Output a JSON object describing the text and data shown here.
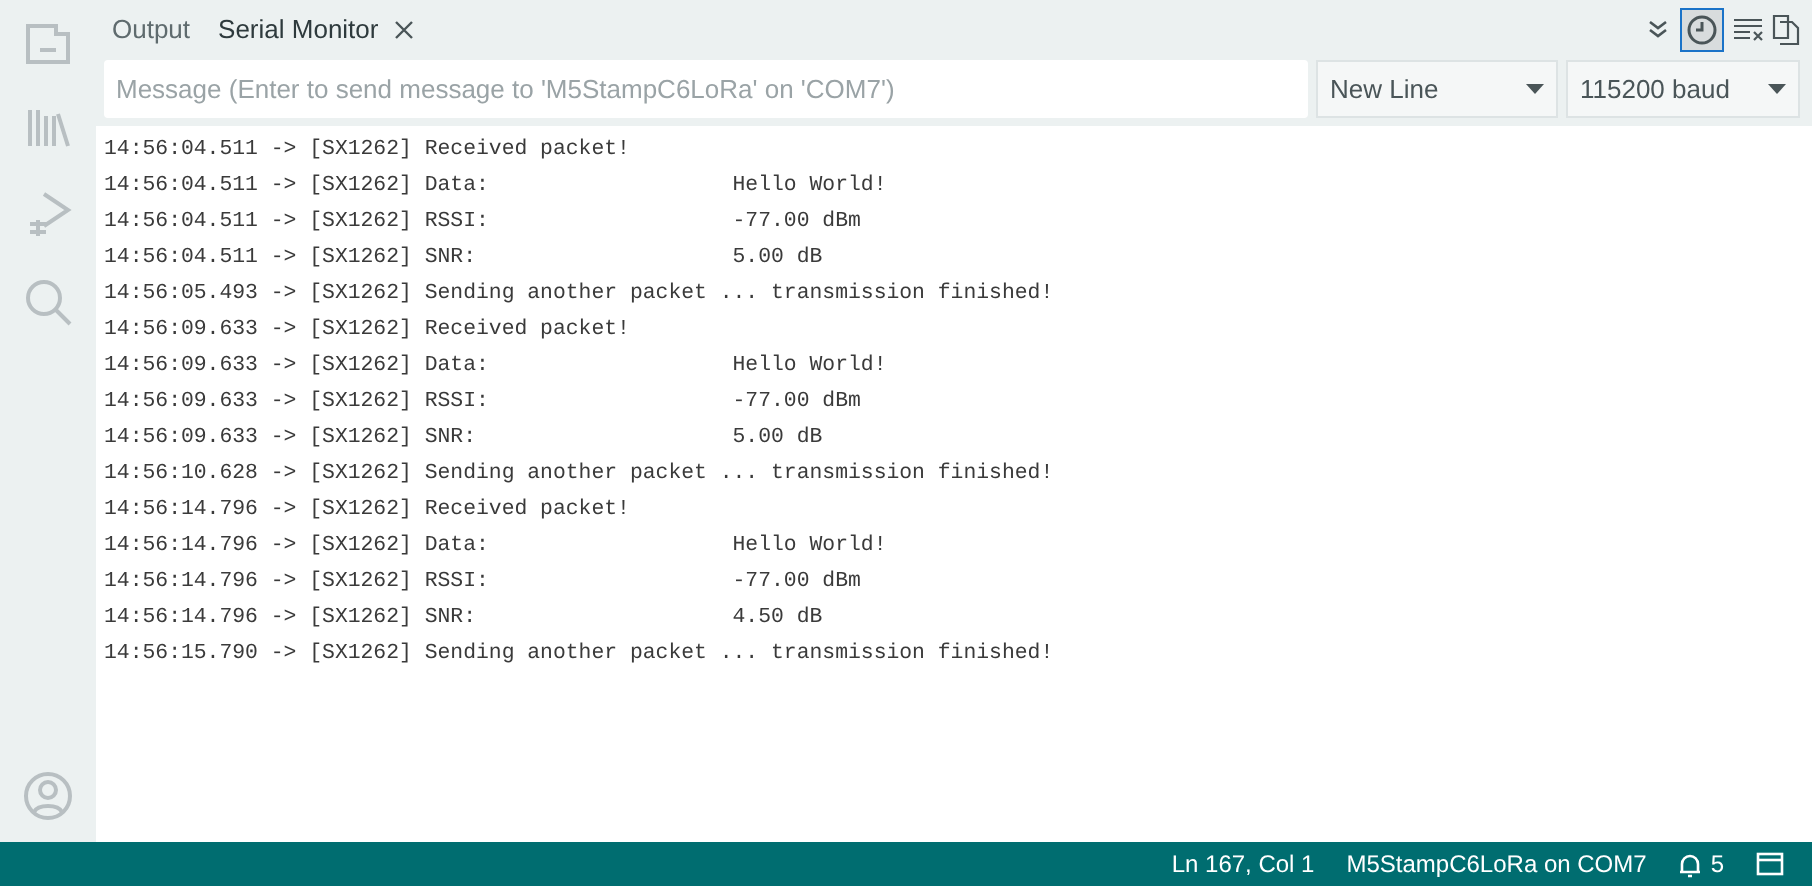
{
  "tabs": [
    {
      "label": "Output",
      "selected": false,
      "closable": false
    },
    {
      "label": "Serial Monitor",
      "selected": true,
      "closable": true
    }
  ],
  "toolbar": {
    "timestamp_on": true
  },
  "message": {
    "placeholder": "Message (Enter to send message to 'M5StampC6LoRa' on 'COM7')"
  },
  "line_ending": {
    "value": "New Line"
  },
  "baud": {
    "value": "115200 baud"
  },
  "log": [
    "14:56:04.511 -> [SX1262] Received packet!",
    "14:56:04.511 -> [SX1262] Data:                   Hello World!",
    "14:56:04.511 -> [SX1262] RSSI:                   -77.00 dBm",
    "14:56:04.511 -> [SX1262] SNR:                    5.00 dB",
    "14:56:05.493 -> [SX1262] Sending another packet ... transmission finished!",
    "14:56:09.633 -> [SX1262] Received packet!",
    "14:56:09.633 -> [SX1262] Data:                   Hello World!",
    "14:56:09.633 -> [SX1262] RSSI:                   -77.00 dBm",
    "14:56:09.633 -> [SX1262] SNR:                    5.00 dB",
    "14:56:10.628 -> [SX1262] Sending another packet ... transmission finished!",
    "14:56:14.796 -> [SX1262] Received packet!",
    "14:56:14.796 -> [SX1262] Data:                   Hello World!",
    "14:56:14.796 -> [SX1262] RSSI:                   -77.00 dBm",
    "14:56:14.796 -> [SX1262] SNR:                    4.50 dB",
    "14:56:15.790 -> [SX1262] Sending another packet ... transmission finished!"
  ],
  "status_bar": {
    "position": "Ln 167, Col 1",
    "board": "M5StampC6LoRa on COM7",
    "notifications": "5"
  }
}
